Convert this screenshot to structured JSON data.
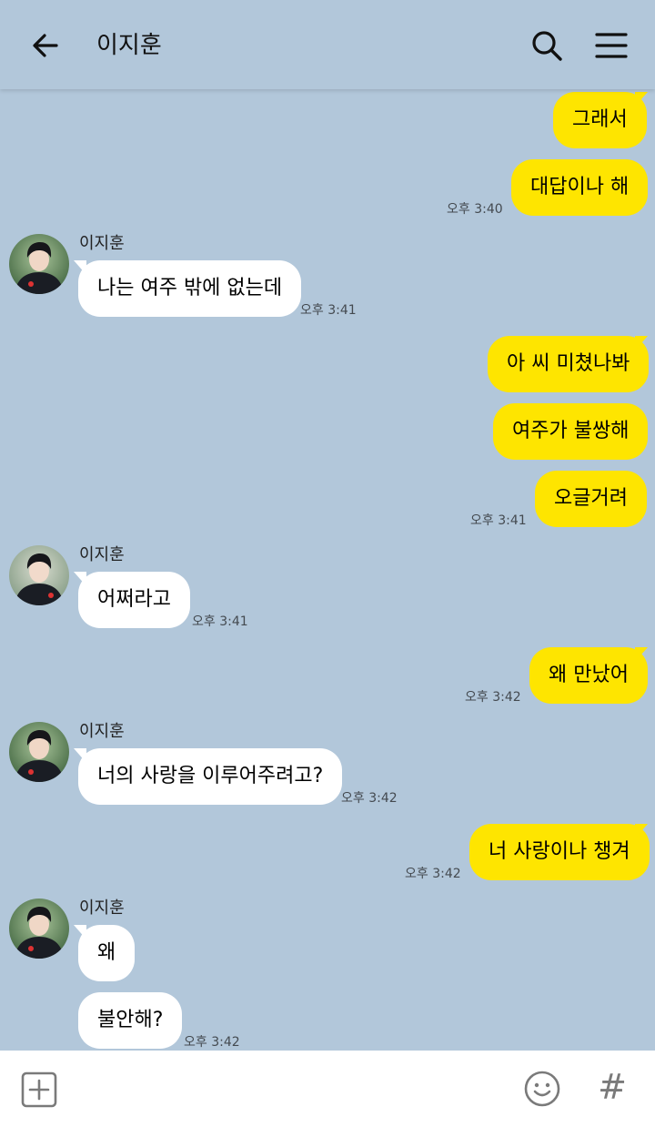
{
  "header": {
    "title": "이지훈",
    "back_icon": "arrow-left-icon",
    "search_icon": "search-icon",
    "menu_icon": "hamburger-menu-icon"
  },
  "contact": {
    "name": "이지훈"
  },
  "messages": {
    "m1": "그래서",
    "m2": "대답이나 해",
    "t1": "오후 3:40",
    "m3": "나는 여주 밖에 없는데",
    "t2": "오후 3:41",
    "m4": "아 씨 미쳤나봐",
    "m5": "여주가 불쌍해",
    "m6": "오글거려",
    "t3": "오후 3:41",
    "m7": "어쩌라고",
    "t4": "오후 3:41",
    "m8": "왜 만났어",
    "t5": "오후 3:42",
    "m9": "너의 사랑을 이루어주려고?",
    "t6": "오후 3:42",
    "m10": "너 사랑이나 챙겨",
    "t7": "오후 3:42",
    "m11": "왜",
    "m12": "불안해?",
    "t8": "오후 3:42"
  },
  "footer": {
    "plus_icon": "plus-square-icon",
    "emoji_icon": "smiley-icon",
    "hash_label": "#"
  },
  "colors": {
    "background": "#b2c7da",
    "my_bubble": "#fee500",
    "their_bubble": "#ffffff"
  }
}
